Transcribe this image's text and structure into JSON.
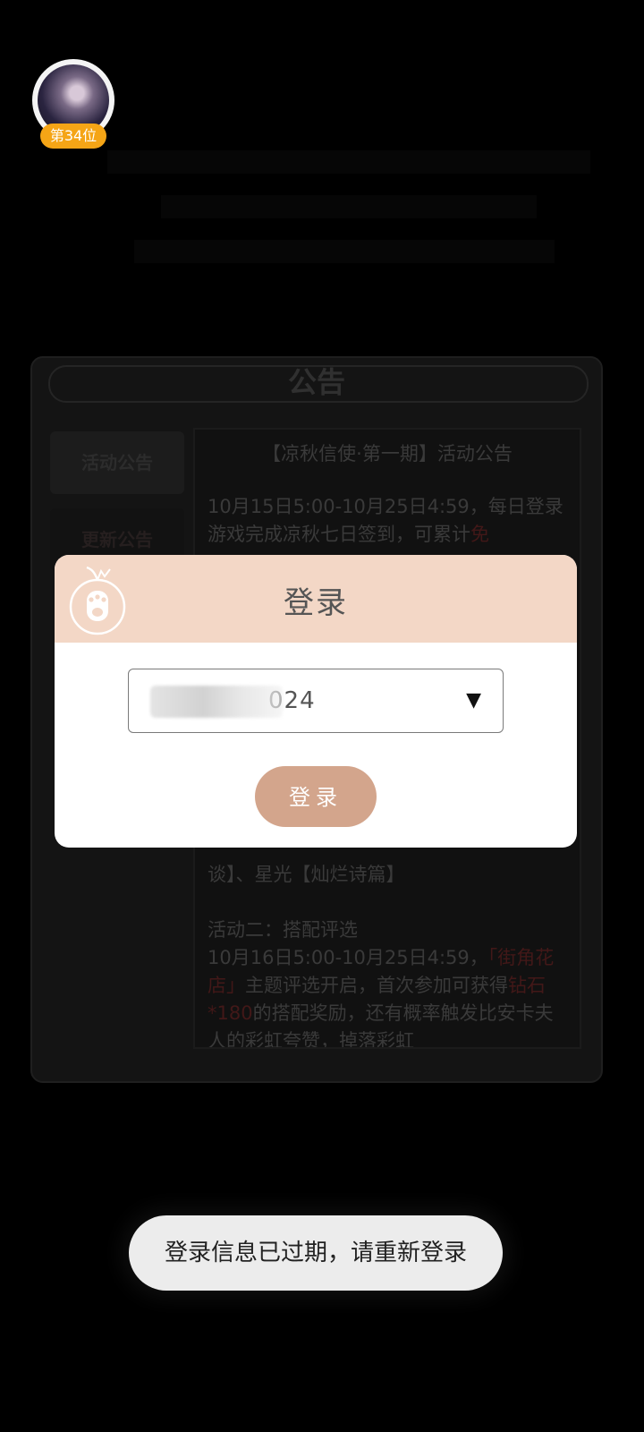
{
  "profile": {
    "rank_label": "第34位"
  },
  "panel": {
    "title": "公告",
    "tabs": [
      {
        "label": "活动公告"
      },
      {
        "label": "更新公告"
      }
    ],
    "content": {
      "title": "【凉秋信使·第一期】活动公告",
      "para1_text": "10月15日5:00-10月25日4:59，每日登录游戏完成凉秋七日签到，可累计",
      "para1_highlight": "免",
      "line_partial": "谈】、星光【灿烂诗篇】",
      "section2_heading": "活动二：搭配评选",
      "section2_text_a": "10月16日5:00-10月25日4:59，",
      "section2_highlight_a": "「街角花店」",
      "section2_text_b": "主题评选开启，首次参加可获得",
      "section2_highlight_b": "钻石*180",
      "section2_text_c": "的搭配奖励，还有概率触发比安卡夫人的彩虹夸赞，掉落彩虹"
    }
  },
  "modal": {
    "title": "登录",
    "account_value": "024",
    "login_button": "登录"
  },
  "toast": {
    "message": "登录信息已过期，请重新登录"
  },
  "colors": {
    "accent_header": "#f3d7c6",
    "login_button": "#d3a58c",
    "rank_badge": "#f5a516"
  },
  "icons": {
    "logo": "cat-paw-peach-icon",
    "dropdown": "caret-down-icon"
  }
}
